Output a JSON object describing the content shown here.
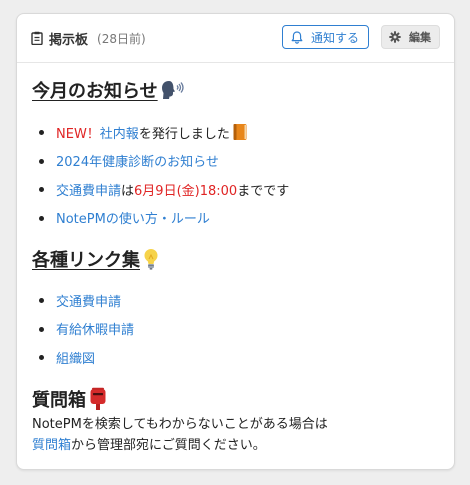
{
  "header": {
    "title": "掲示板",
    "time": "(28日前)",
    "notify_label": "通知する",
    "edit_label": "編集"
  },
  "announcements": {
    "heading": "今月のお知らせ",
    "items": [
      {
        "prefix": "NEW！",
        "link": "社内報",
        "suffix": "を発行しました"
      },
      {
        "link": "2024年健康診断のお知らせ"
      },
      {
        "link": "交通費申請",
        "mid": "は",
        "highlight": "6月9日(金)18:00",
        "suffix": "までです"
      },
      {
        "link": "NotePMの使い方・ルール"
      }
    ]
  },
  "links": {
    "heading": "各種リンク集",
    "items": [
      "交通費申請",
      "有給休暇申請",
      "組織図"
    ]
  },
  "questions": {
    "heading": "質問箱",
    "line1": "NotePMを検索してもわからないことがある場合は",
    "line2_link": "質問箱",
    "line2_rest": "から管理部宛にご質問ください。"
  },
  "colors": {
    "link": "#2f7fd1",
    "highlight": "#e02424"
  },
  "icons": {
    "title": "clipboard-icon",
    "notify": "bell-icon",
    "edit": "gear-icon",
    "announcements_emoji": "speaking-head-icon",
    "item1_emoji": "orange-book-icon",
    "links_emoji": "light-bulb-icon",
    "questions_emoji": "postbox-icon"
  }
}
